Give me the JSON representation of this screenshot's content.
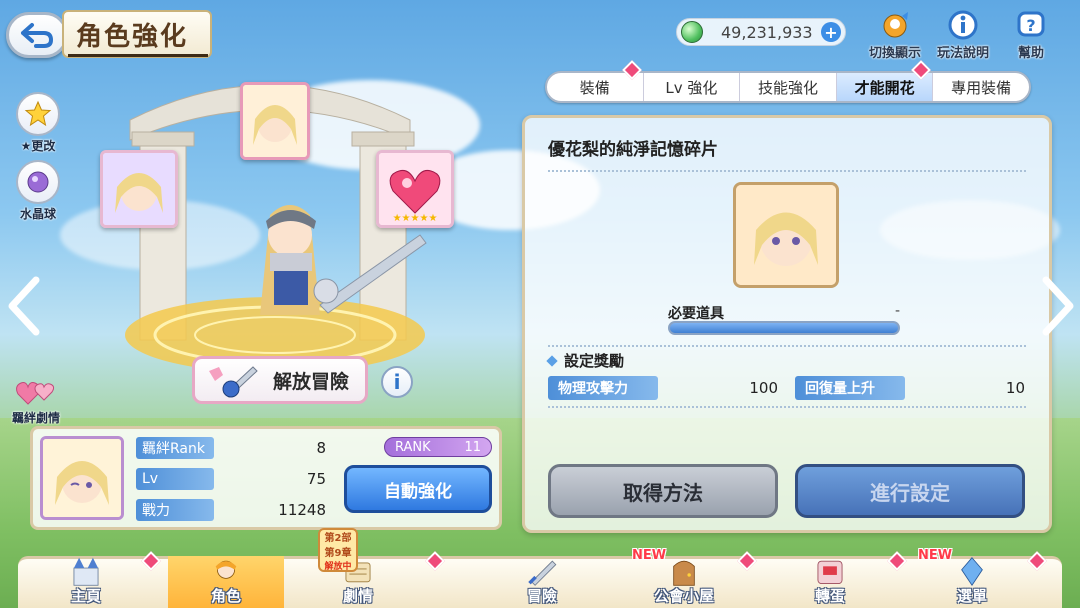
{
  "header": {
    "title": "角色強化",
    "currency_value": "49,231,933",
    "icons": [
      {
        "label": "切換顯示"
      },
      {
        "label": "玩法說明"
      },
      {
        "label": "幫助"
      }
    ]
  },
  "side": {
    "change_label": "★更改",
    "crystal_label": "水晶球",
    "bond_story_label": "羈絆劇情"
  },
  "tabs": [
    {
      "label": "裝備"
    },
    {
      "label": "Lv 強化"
    },
    {
      "label": "技能強化"
    },
    {
      "label": "才能開花"
    },
    {
      "label": "專用裝備"
    }
  ],
  "panel": {
    "item_name": "優花梨的純淨記憶碎片",
    "required_label": "必要道具",
    "required_value": "-",
    "settings_label": "設定獎勵",
    "stats": [
      {
        "name": "物理攻擊力",
        "value": "100"
      },
      {
        "name": "回復量上升",
        "value": "10"
      }
    ],
    "obtain_button": "取得方法",
    "confirm_button": "進行設定"
  },
  "character": {
    "release_label": "解放冒險",
    "rank_label": "RANK",
    "rank_value": "11",
    "rows": [
      {
        "name": "羈絆Rank",
        "value": "8"
      },
      {
        "name": "Lv",
        "value": "75"
      },
      {
        "name": "戰力",
        "value": "11248"
      }
    ],
    "auto_button": "自動強化"
  },
  "event_badge": {
    "line1": "第2部",
    "line2": "第9章",
    "line3": "解放中"
  },
  "nav": [
    {
      "label": "主頁"
    },
    {
      "label": "角色"
    },
    {
      "label": "劇情"
    },
    {
      "label": "冒險"
    },
    {
      "label": "公會小屋"
    },
    {
      "label": "轉蛋"
    },
    {
      "label": "選單"
    }
  ],
  "nav_new_label": "NEW"
}
